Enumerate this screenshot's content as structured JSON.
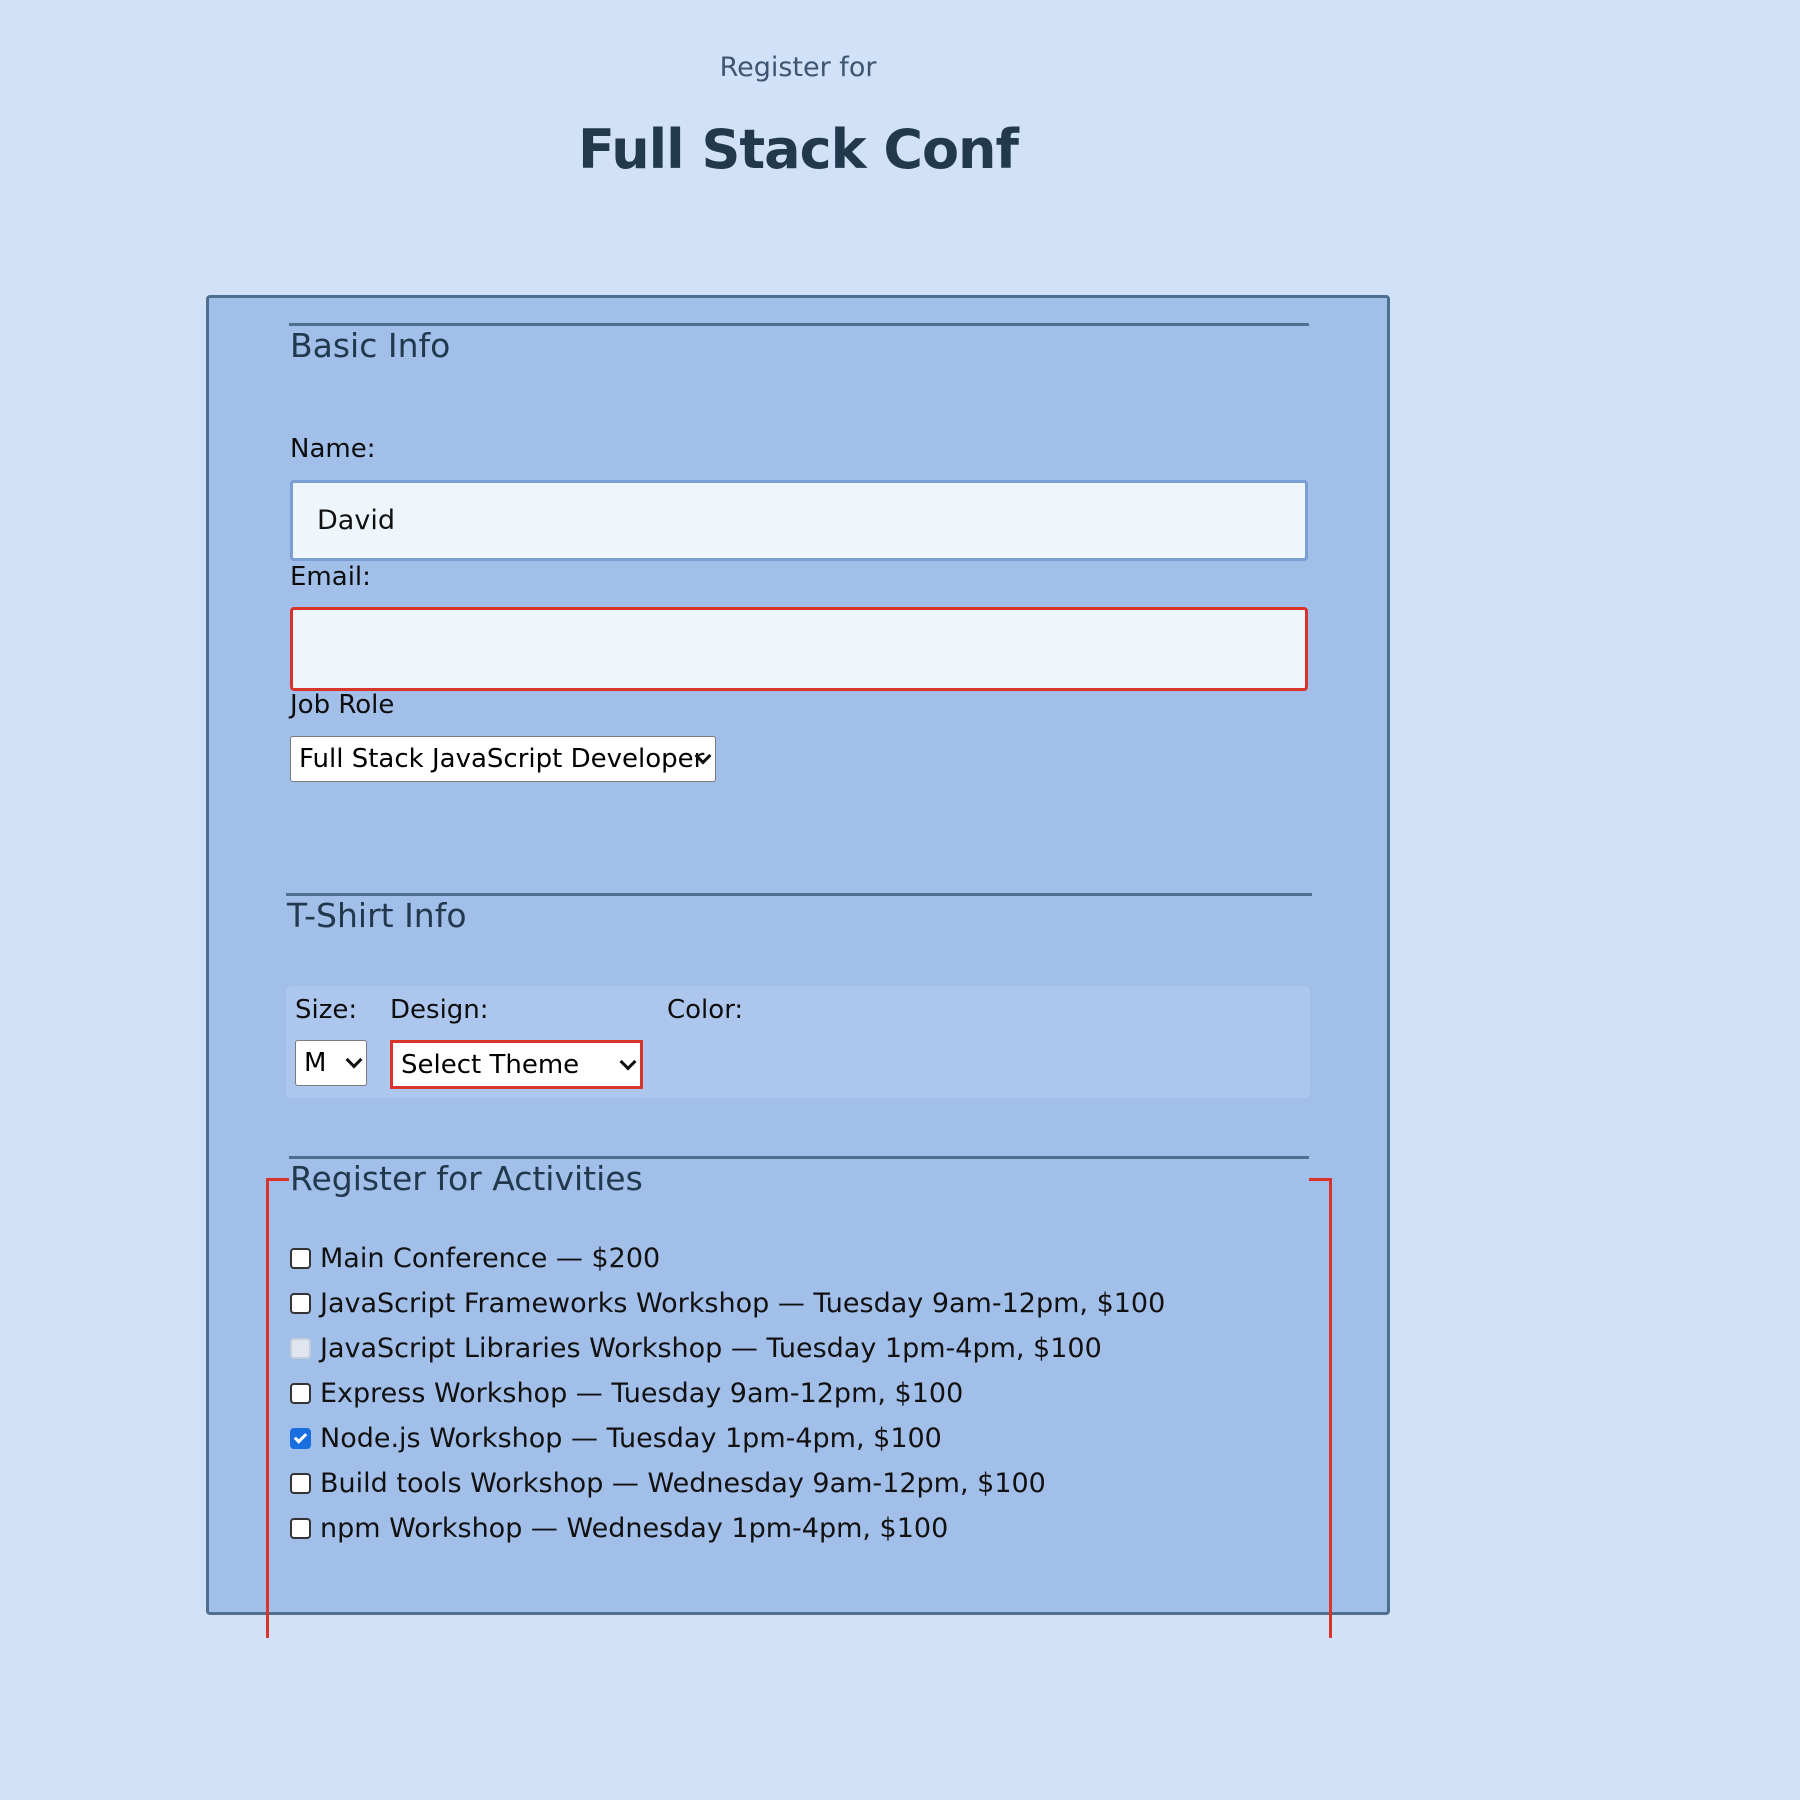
{
  "header": {
    "pre_title": "Register for",
    "title": "Full Stack Conf"
  },
  "basic_info": {
    "legend": "Basic Info",
    "name_label": "Name:",
    "name_value": "David",
    "email_label": "Email:",
    "email_value": "",
    "job_role_label": "Job Role",
    "job_role_selected": "Full Stack JavaScript Developer"
  },
  "tshirt": {
    "legend": "T-Shirt Info",
    "size_label": "Size:",
    "size_selected": "M",
    "design_label": "Design:",
    "design_selected": "Select Theme",
    "color_label": "Color:"
  },
  "activities": {
    "legend": "Register for Activities",
    "items": [
      {
        "label": "Main Conference — $200",
        "checked": false,
        "disabled": false
      },
      {
        "label": "JavaScript Frameworks Workshop — Tuesday 9am-12pm, $100",
        "checked": false,
        "disabled": false
      },
      {
        "label": "JavaScript Libraries Workshop — Tuesday 1pm-4pm, $100",
        "checked": false,
        "disabled": true
      },
      {
        "label": "Express Workshop — Tuesday 9am-12pm, $100",
        "checked": false,
        "disabled": false
      },
      {
        "label": "Node.js Workshop — Tuesday 1pm-4pm, $100",
        "checked": true,
        "disabled": false
      },
      {
        "label": "Build tools Workshop — Wednesday 9am-12pm, $100",
        "checked": false,
        "disabled": false
      },
      {
        "label": "npm Workshop — Wednesday 1pm-4pm, $100",
        "checked": false,
        "disabled": false
      }
    ]
  },
  "colors": {
    "page_background": "#d1e1f7",
    "form_background": "#a2bfea",
    "error_border": "#d9342b",
    "heading": "#22384d",
    "checkbox_checked": "#1a6fe0"
  }
}
